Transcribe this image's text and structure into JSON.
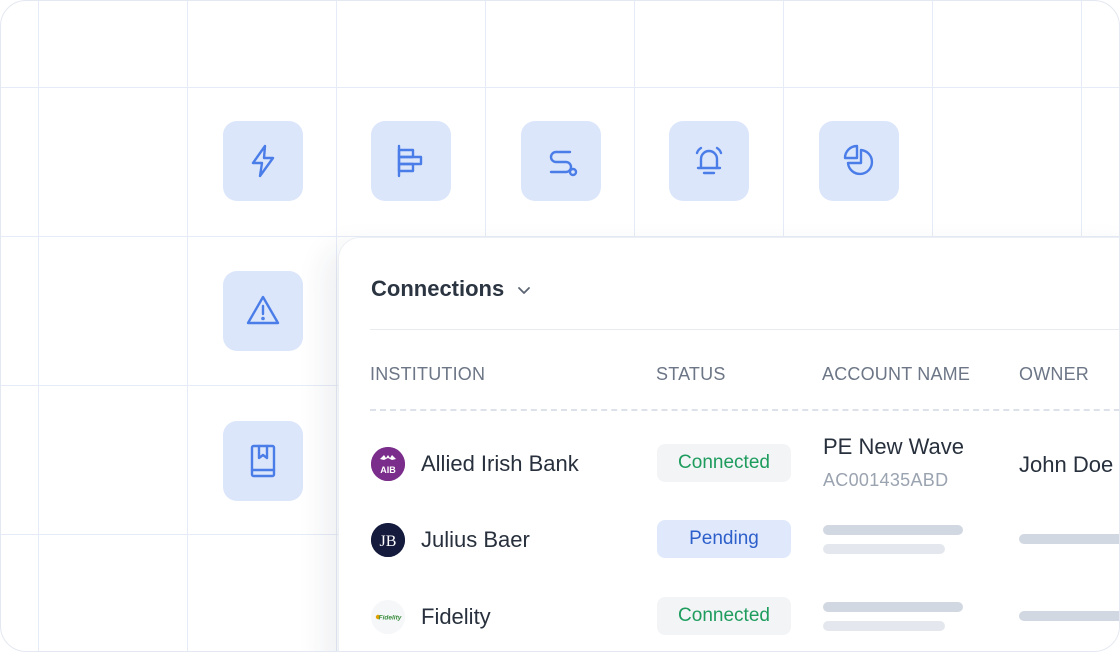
{
  "toolbar_tiles": [
    {
      "icon": "lightning-icon"
    },
    {
      "icon": "align-bars-icon"
    },
    {
      "icon": "route-icon"
    },
    {
      "icon": "alarm-bell-icon"
    },
    {
      "icon": "pie-chart-icon"
    },
    {
      "icon": "warning-triangle-icon"
    },
    {
      "icon": "bookmark-book-icon"
    }
  ],
  "connections": {
    "title": "Connections",
    "columns": {
      "institution": "INSTITUTION",
      "status": "STATUS",
      "account_name": "ACCOUNT NAME",
      "owner": "OWNER"
    },
    "rows": [
      {
        "institution": "Allied Irish Bank",
        "logo_text": "AIB",
        "logo_color": "#7a2d8a",
        "status": "Connected",
        "account_name": "PE New Wave",
        "account_number": "AC001435ABD",
        "owner": "John Doe"
      },
      {
        "institution": "Julius Baer",
        "logo_text": "JB",
        "logo_color": "#141b3c",
        "status": "Pending"
      },
      {
        "institution": "Fidelity",
        "logo_text": "Fidelity",
        "logo_color": "#3a8d3f",
        "status": "Connected"
      }
    ]
  },
  "colors": {
    "accent": "#4a7de8",
    "tile_bg": "#dbe6fb",
    "connected": "#1e9c5e",
    "pending": "#2d5fcb"
  }
}
